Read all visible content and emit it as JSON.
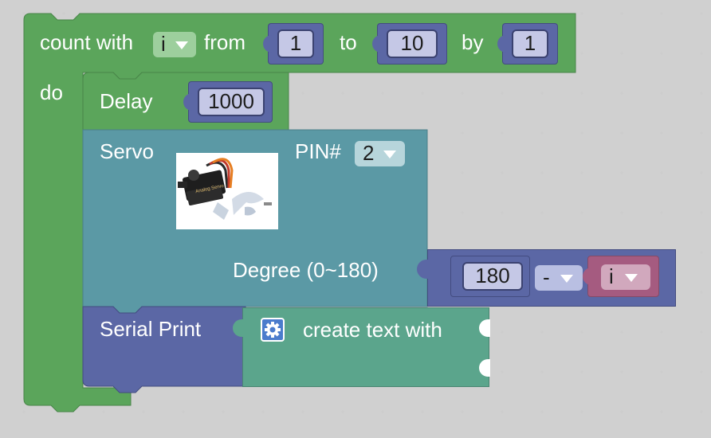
{
  "loop": {
    "count_with": "count with",
    "variable": "i",
    "from_label": "from",
    "from_value": "1",
    "to_label": "to",
    "to_value": "10",
    "by_label": "by",
    "by_value": "1",
    "do_label": "do"
  },
  "delay": {
    "label": "Delay",
    "value": "1000"
  },
  "servo": {
    "label": "Servo",
    "pin_label": "PIN#",
    "pin_value": "2",
    "degree_label": "Degree (0~180)",
    "image_icon": "servo-motor-image",
    "image_caption": "Analog Servo"
  },
  "math": {
    "left_value": "180",
    "operator": "-",
    "variable": "i"
  },
  "serial": {
    "label": "Serial Print",
    "create_text": "create text with",
    "gear_icon": "gear-icon"
  },
  "colors": {
    "loop": "#5ba55b",
    "servo": "#5b99a5",
    "math": "#5b67a5",
    "variable": "#a55b80",
    "text": "#5ba58c",
    "background_dot": "#cccccc"
  }
}
